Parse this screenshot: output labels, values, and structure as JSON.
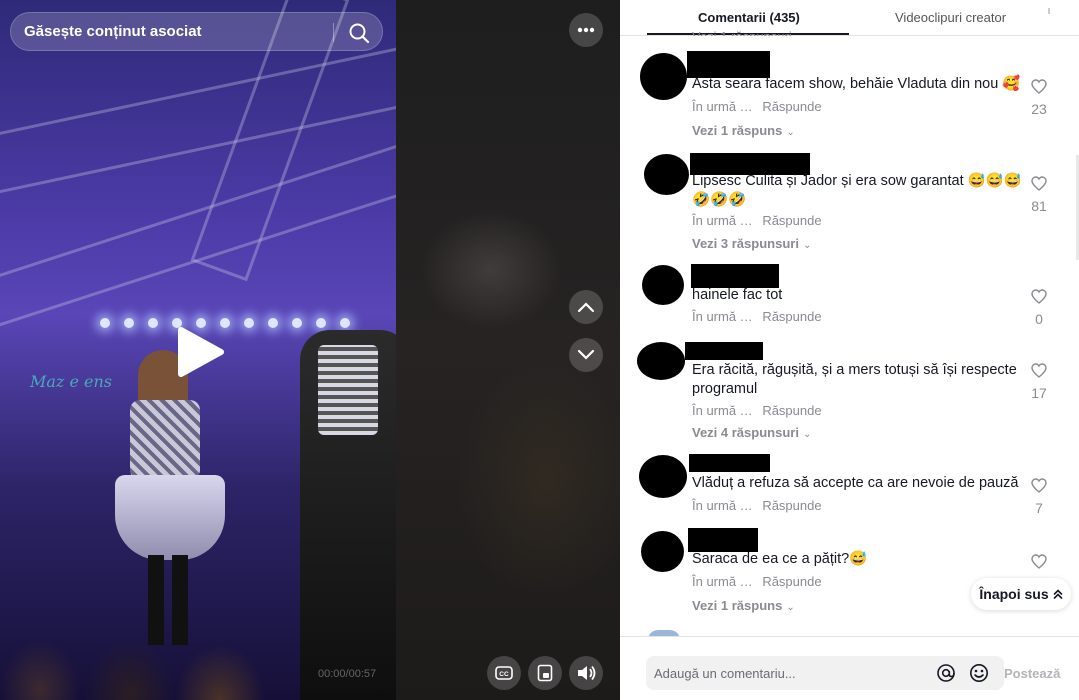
{
  "search": {
    "placeholder": "Găsește conținut asociat"
  },
  "video": {
    "timecode": "00:00/00:57",
    "stage_text": "Maz e ens"
  },
  "icons": {
    "search": "search-icon",
    "more": "ellipsis-icon",
    "up": "chevron-up-icon",
    "down": "chevron-down-icon",
    "play": "play-icon",
    "captions": "captions-icon",
    "floating": "floating-player-icon",
    "volume": "volume-icon",
    "like": "heart-icon",
    "mention": "at-icon",
    "emoji": "emoji-icon"
  },
  "tabs": [
    {
      "label": "Comentarii (435)",
      "active": true
    },
    {
      "label": "Videoclipuri creator",
      "active": false
    }
  ],
  "prev_reply_text": "Vezi 1 răspunsuri",
  "comments": [
    {
      "text": "Asta seara facem show, behăie Vladuta din nou 🥰",
      "time": "În urmă …",
      "reply": "Răspunde",
      "likes": "23",
      "more_replies": "Vezi 1 răspuns"
    },
    {
      "text": "Lipsesc Culita și Jador și era sow garantat 😅😅😅 🤣🤣🤣",
      "time": "În urmă …",
      "reply": "Răspunde",
      "likes": "81",
      "more_replies": "Vezi 3 răspunsuri"
    },
    {
      "text": "hainele fac tot",
      "time": "În urmă …",
      "reply": "Răspunde",
      "likes": "0",
      "more_replies": ""
    },
    {
      "text": "Era răcită, răgușită, și a mers totuși să își respecte programul",
      "time": "În urmă …",
      "reply": "Răspunde",
      "likes": "17",
      "more_replies": "Vezi 4 răspunsuri"
    },
    {
      "text": "Vlăduț a refuza să accepte ca are nevoie de pauză",
      "time": "În urmă …",
      "reply": "Răspunde",
      "likes": "7",
      "more_replies": ""
    },
    {
      "text": "Saraca de ea ce a pățit?😅",
      "time": "În urmă …",
      "reply": "Răspunde",
      "likes": "11",
      "more_replies": "Vezi 1 răspuns"
    }
  ],
  "back_to_top": {
    "label": "Înapoi sus",
    "icon": "double-chevron-up-icon"
  },
  "footer": {
    "input_placeholder": "Adaugă un comentariu...",
    "post_label": "Postează"
  }
}
